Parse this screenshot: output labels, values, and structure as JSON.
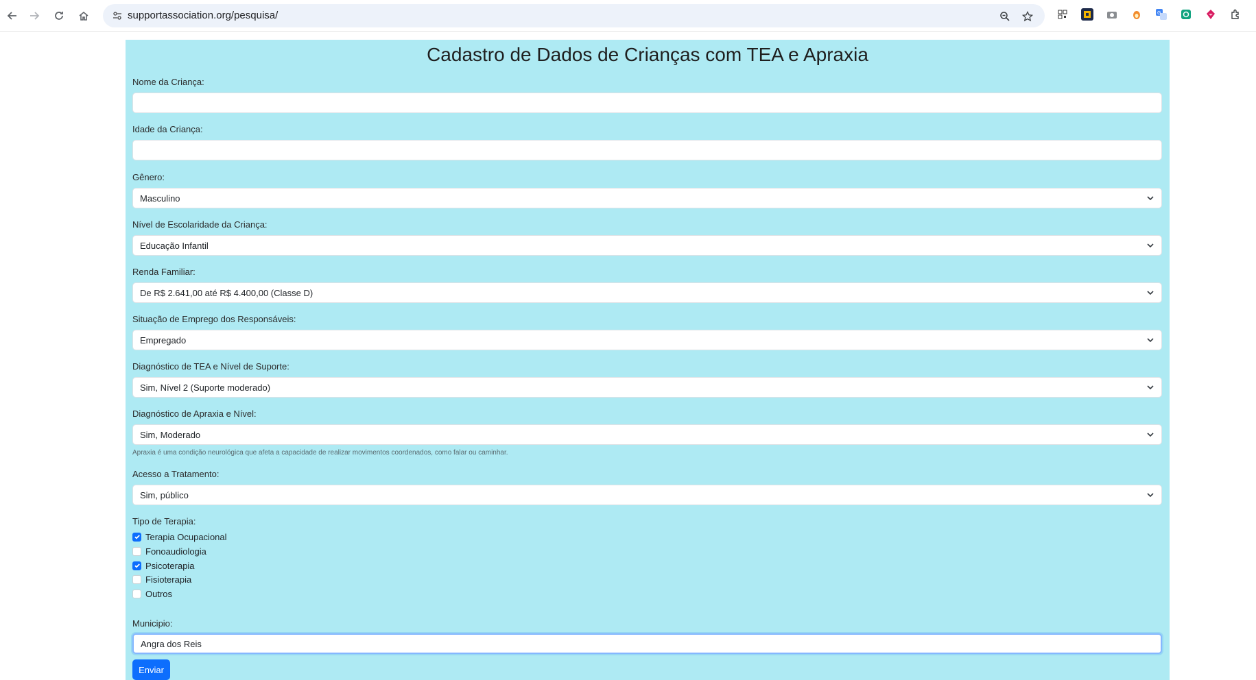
{
  "browser": {
    "url": "supportassociation.org/pesquisa/",
    "icons": [
      "back-arrow-icon",
      "forward-arrow-icon",
      "reload-icon",
      "home-icon",
      "site-info-icon",
      "zoom-icon",
      "bookmark-star-icon",
      "qr-icon",
      "extension-icon",
      "camera-icon",
      "extension-icon",
      "translate-icon",
      "extension-icon",
      "extension-icon",
      "puzzle-icon"
    ]
  },
  "form": {
    "title": "Cadastro de Dados de Crianças com TEA e Apraxia",
    "nome_label": "Nome da Criança:",
    "nome_value": "",
    "idade_label": "Idade da Criança:",
    "idade_value": "",
    "genero_label": "Gênero:",
    "genero_value": "Masculino",
    "escolaridade_label": "Nível de Escolaridade da Criança:",
    "escolaridade_value": "Educação Infantil",
    "renda_label": "Renda Familiar:",
    "renda_value": "De R$ 2.641,00 até R$ 4.400,00 (Classe D)",
    "emprego_label": "Situação de Emprego dos Responsáveis:",
    "emprego_value": "Empregado",
    "tea_label": "Diagnóstico de TEA e Nível de Suporte:",
    "tea_value": "Sim, Nível 2 (Suporte moderado)",
    "apraxia_label": "Diagnóstico de Apraxia e Nível:",
    "apraxia_value": "Sim, Moderado",
    "apraxia_help": "Apraxia é uma condição neurológica que afeta a capacidade de realizar movimentos coordenados, como falar ou caminhar.",
    "acesso_label": "Acesso a Tratamento:",
    "acesso_value": "Sim, público",
    "terapia_label": "Tipo de Terapia:",
    "terapias": [
      {
        "label": "Terapia Ocupacional",
        "checked": true
      },
      {
        "label": "Fonoaudiologia",
        "checked": false
      },
      {
        "label": "Psicoterapia",
        "checked": true
      },
      {
        "label": "Fisioterapia",
        "checked": false
      },
      {
        "label": "Outros",
        "checked": false
      }
    ],
    "municipio_label": "Municipio:",
    "municipio_value": "Angra dos Reis",
    "submit_label": "Enviar"
  },
  "colors": {
    "page_bg": "#aeeaf3",
    "primary": "#0d6efd"
  }
}
